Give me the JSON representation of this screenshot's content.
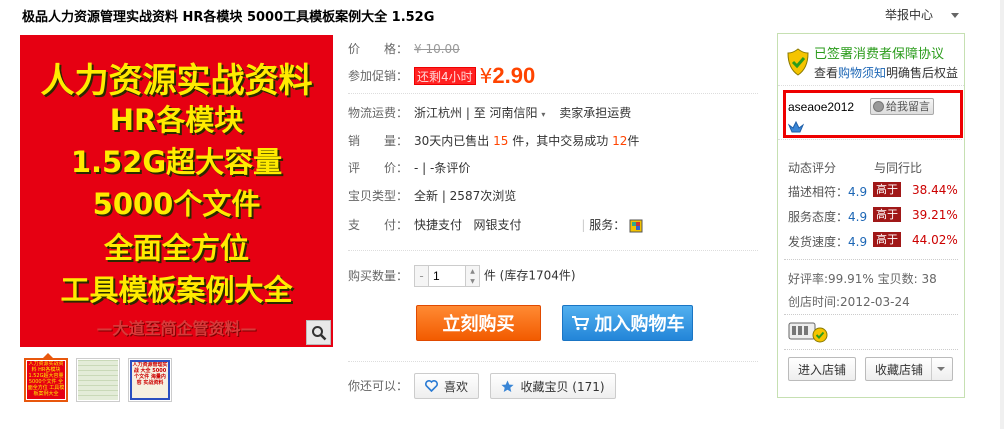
{
  "title": "极品人力资源管理实战资料 HR各模块 5000工具模板案例大全 1.52G",
  "report": "举报中心",
  "main_image": {
    "lines": [
      "人力资源实战资料",
      "HR各模块",
      "1.52G超大容量",
      "5000个文件",
      "全面全方位",
      "工具模板案例大全",
      "—大道至简企管资料—"
    ]
  },
  "thumbs": [
    {
      "text": "人力资源实战资料 HR各模块 1.52G超大容量 5000个文件 全面全方位 工具模板案例大全",
      "bg": "#e60012",
      "color": "#ffeb00"
    },
    {
      "text": "",
      "bg": "#e8efe0",
      "color": "#666"
    },
    {
      "text": "人力资源管理实战 大全 5000个文件 海量内容 实战资料",
      "bg": "#f4f4f4",
      "color": "#c00"
    }
  ],
  "price": {
    "label": "价　　格：",
    "value": "¥ 10.00"
  },
  "promo": {
    "label": "参加促销：",
    "tag": "还剩4小时",
    "yen": "¥",
    "value": "2.90"
  },
  "shipping": {
    "label": "物流运费：",
    "from": "浙江杭州",
    "sep": "| 至",
    "to": "河南信阳",
    "note": "卖家承担运费"
  },
  "sales": {
    "label": "销　　量：",
    "pre": "30天内已售出",
    "count": "15",
    "mid": "件，其中交易成功",
    "success": "12",
    "post": "件"
  },
  "rating": {
    "label": "评　　价：",
    "text": "-  |  -条评价"
  },
  "type": {
    "label": "宝贝类型：",
    "text": "全新  |  2587次浏览"
  },
  "payment": {
    "label": "支　　付：",
    "opt1": "快捷支付",
    "opt2": "网银支付",
    "service_label": "服务："
  },
  "quantity": {
    "label": "购买数量：",
    "value": "1",
    "stock": "件 (库存1704件)"
  },
  "buttons": {
    "buy": "立刻购买",
    "cart": "加入购物车"
  },
  "also": {
    "label": "你还可以：",
    "like": "喜欢",
    "fav": "收藏宝贝 (171)"
  },
  "sidebar": {
    "guarantee": "已签署消费者保障协议",
    "notice_pre": "查看",
    "notice_link": "购物须知",
    "notice_post": "明确售后权益",
    "seller_name": "aseaoe2012",
    "message": "给我留言",
    "dynamic_label": "动态评分",
    "compare_label": "与同行比",
    "scores": [
      {
        "label": "描述相符：",
        "value": "4.9",
        "cmp": "高于",
        "pct": "38.44%"
      },
      {
        "label": "服务态度：",
        "value": "4.9",
        "cmp": "高于",
        "pct": "39.21%"
      },
      {
        "label": "发货速度：",
        "value": "4.9",
        "cmp": "高于",
        "pct": "44.02%"
      }
    ],
    "good_rate": "好评率:99.91% 宝贝数: 38",
    "created": "创店时间:2012-03-24",
    "enter_shop": "进入店铺",
    "fav_shop": "收藏店铺"
  },
  "colors": {
    "accent": "#ff4400",
    "brand_green": "#2b9c1c",
    "link": "#1c66b5"
  }
}
